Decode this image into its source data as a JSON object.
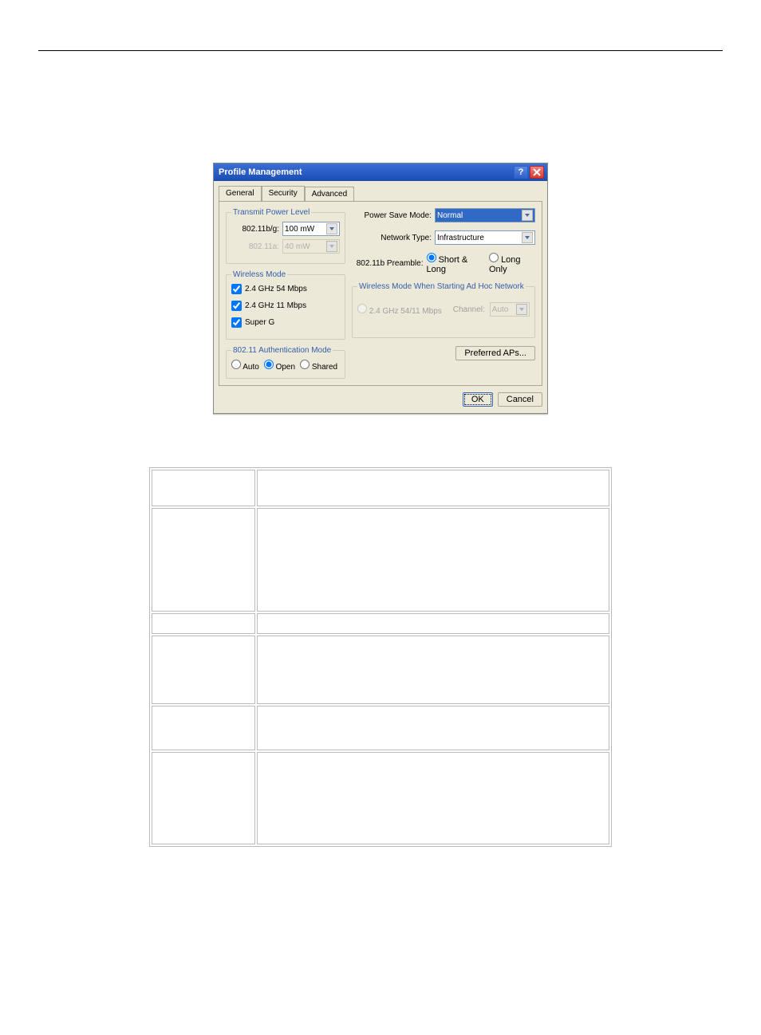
{
  "window": {
    "title": "Profile Management",
    "help_label": "?",
    "close_label": "×"
  },
  "tabs": {
    "general": "General",
    "security": "Security",
    "advanced": "Advanced"
  },
  "transmit_power": {
    "legend": "Transmit Power Level",
    "bg_label": "802.11b/g:",
    "bg_value": "100 mW",
    "a_label": "802.11a:",
    "a_value": "40 mW"
  },
  "wireless_mode": {
    "legend": "Wireless Mode",
    "m54": "2.4 GHz 54 Mbps",
    "m11": "2.4 GHz 11 Mbps",
    "superg": "Super G"
  },
  "auth_mode": {
    "legend": "802.11 Authentication Mode",
    "auto": "Auto",
    "open": "Open",
    "shared": "Shared"
  },
  "right": {
    "psm_label": "Power Save Mode:",
    "psm_value": "Normal",
    "nt_label": "Network Type:",
    "nt_value": "Infrastructure",
    "preamble_label": "802.11b Preamble:",
    "preamble_shortlong": "Short & Long",
    "preamble_longonly": "Long Only"
  },
  "adhoc": {
    "legend": "Wireless Mode When Starting Ad Hoc Network",
    "mode_label": "2.4 GHz 54/11 Mbps",
    "channel_label": "Channel:",
    "channel_value": "Auto"
  },
  "buttons": {
    "preferred": "Preferred APs...",
    "ok": "OK",
    "cancel": "Cancel"
  }
}
